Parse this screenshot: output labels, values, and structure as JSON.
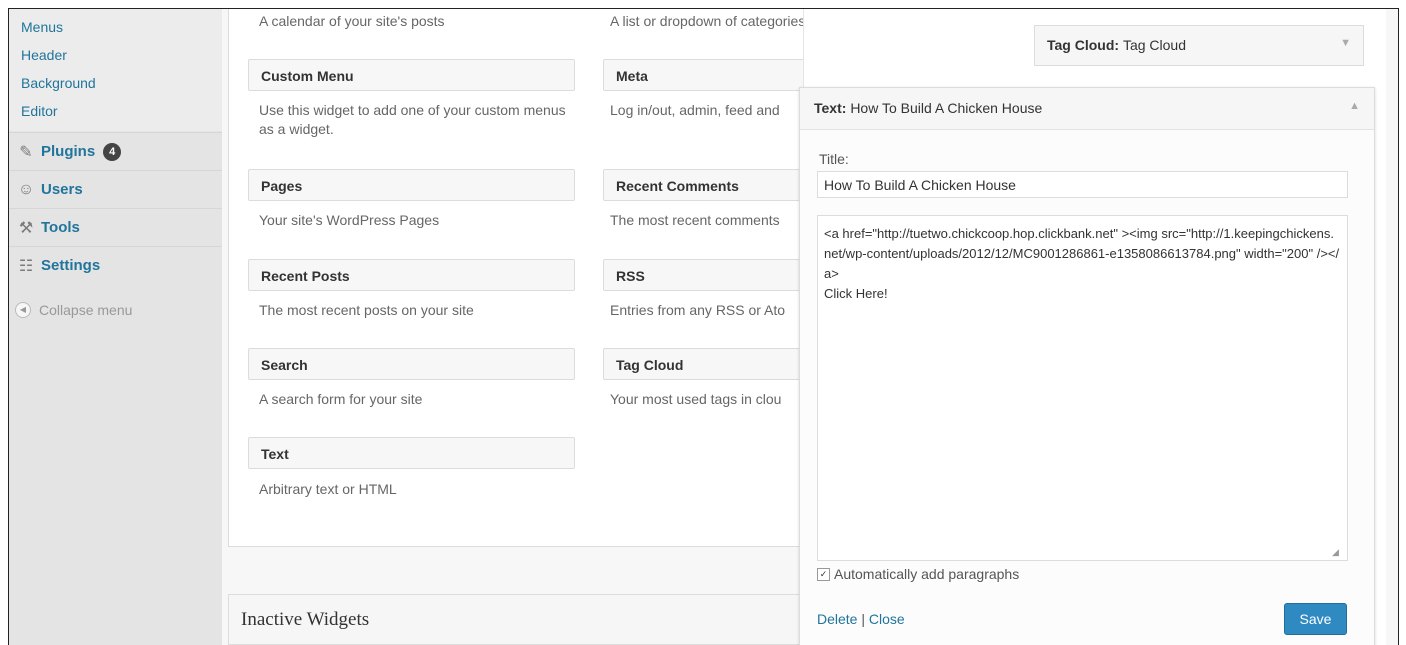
{
  "sidebar": {
    "submenu": [
      "Menus",
      "Header",
      "Background",
      "Editor"
    ],
    "items": [
      {
        "label": "Plugins",
        "icon": "plug-icon",
        "badge": "4"
      },
      {
        "label": "Users",
        "icon": "users-icon"
      },
      {
        "label": "Tools",
        "icon": "tools-icon"
      },
      {
        "label": "Settings",
        "icon": "settings-icon"
      }
    ],
    "collapse_label": "Collapse menu"
  },
  "available": {
    "top_descs": [
      "A calendar of your site's posts",
      "A list or dropdown of categories"
    ],
    "widgets": [
      {
        "name": "Custom Menu",
        "desc": "Use this widget to add one of your custom menus as a widget."
      },
      {
        "name": "Meta",
        "desc": "Log in/out, admin, feed and"
      },
      {
        "name": "Pages",
        "desc": "Your site's WordPress Pages"
      },
      {
        "name": "Recent Comments",
        "desc": "The most recent comments"
      },
      {
        "name": "Recent Posts",
        "desc": "The most recent posts on your site"
      },
      {
        "name": "RSS",
        "desc": "Entries from any RSS or Ato"
      },
      {
        "name": "Search",
        "desc": "A search form for your site"
      },
      {
        "name": "Tag Cloud",
        "desc": "Your most used tags in clou"
      },
      {
        "name": "Text",
        "desc": "Arbitrary text or HTML"
      }
    ]
  },
  "inactive_title": "Inactive Widgets",
  "sidebar_area": {
    "tagcloud_type": "Tag Cloud:",
    "tagcloud_title": "Tag Cloud"
  },
  "editor": {
    "type": "Text:",
    "header_title": "How To Build A Chicken House",
    "title_label": "Title:",
    "title_value": "How To Build A Chicken House",
    "content": "<a href=\"http://tuetwo.chickcoop.hop.clickbank.net\" ><img src=\"http://1.keepingchickens.net/wp-content/uploads/2012/12/MC9001286861-e1358086613784.png\" width=\"200\" /></a>\nClick Here!",
    "autop_label": "Automatically add paragraphs",
    "autop_checked": true,
    "delete_label": "Delete",
    "separator": "|",
    "close_label": "Close",
    "save_label": "Save"
  }
}
